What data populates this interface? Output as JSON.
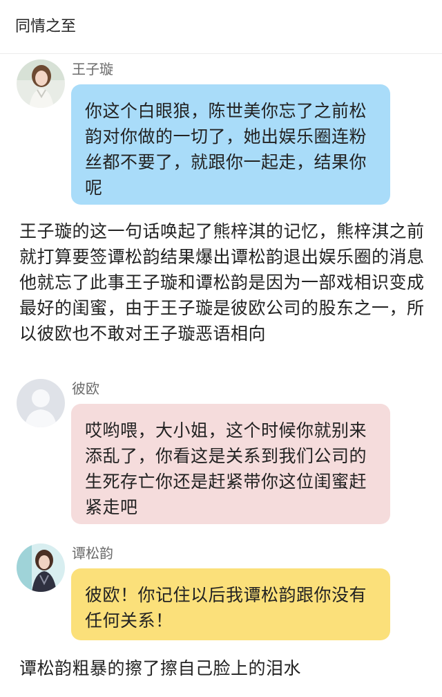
{
  "header": {
    "title": "同情之至"
  },
  "messages": [
    {
      "name": "王子璇",
      "text": "你这个白眼狼，陈世美你忘了之前松韵对你做的一切了，她出娱乐圈连粉丝都不要了，就跟你一起走，结果你呢",
      "bubble_color": "#a9dcf9"
    },
    {
      "name": "彼欧",
      "text": "哎哟喂，大小姐，这个时候你就别来添乱了，你看这是关系到我们公司的生死存亡你还是赶紧带你这位闺蜜赶紧走吧",
      "bubble_color": "#f5dcdc"
    },
    {
      "name": "谭松韵",
      "text": "彼欧！你记住以后我谭松韵跟你没有任何关系！",
      "bubble_color": "#fbe07a"
    }
  ],
  "narrations": [
    "王子璇的这一句话唤起了熊梓淇的记忆，熊梓淇之前就打算要签谭松韵结果爆出谭松韵退出娱乐圈的消息他就忘了此事王子璇和谭松韵是因为一部戏相识变成最好的闺蜜，由于王子璇是彼欧公司的股东之一，所以彼欧也不敢对王子璇恶语相向",
    "谭松韵粗暴的擦了擦自己脸上的泪水"
  ]
}
